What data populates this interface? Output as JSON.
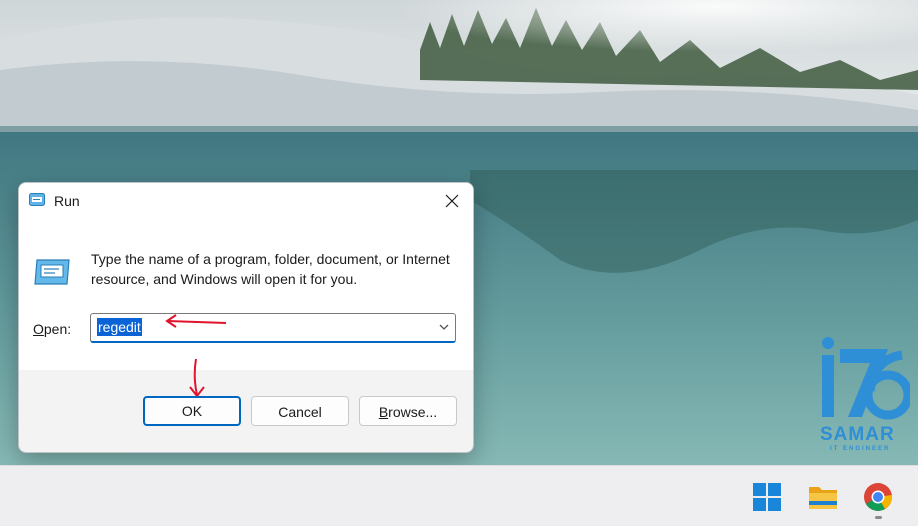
{
  "run_dialog": {
    "title": "Run",
    "description": "Type the name of a program, folder, document, or Internet resource, and Windows will open it for you.",
    "open_label_mnemonic": "O",
    "open_label_rest": "pen:",
    "open_value": "regedit",
    "ok_label": "OK",
    "cancel_label": "Cancel",
    "browse_label_mnemonic": "B",
    "browse_label_rest": "rowse...",
    "icons": {
      "title": "run-icon",
      "body": "run-icon",
      "close": "close-icon",
      "dropdown": "chevron-down-icon"
    }
  },
  "annotations": {
    "arrow_color": "#e0142c",
    "arrows": [
      "arrow-left-to-input",
      "arrow-down-to-ok"
    ]
  },
  "watermark": {
    "name": "SAMAR",
    "subtitle": "IT ENGINEER",
    "color": "#2f8fd6"
  },
  "taskbar": {
    "icons": [
      "windows-start-icon",
      "file-explorer-icon",
      "chrome-icon"
    ]
  },
  "colors": {
    "accent": "#0067c0",
    "selection": "#0a64d8",
    "taskbar_bg": "#eeeef0"
  }
}
